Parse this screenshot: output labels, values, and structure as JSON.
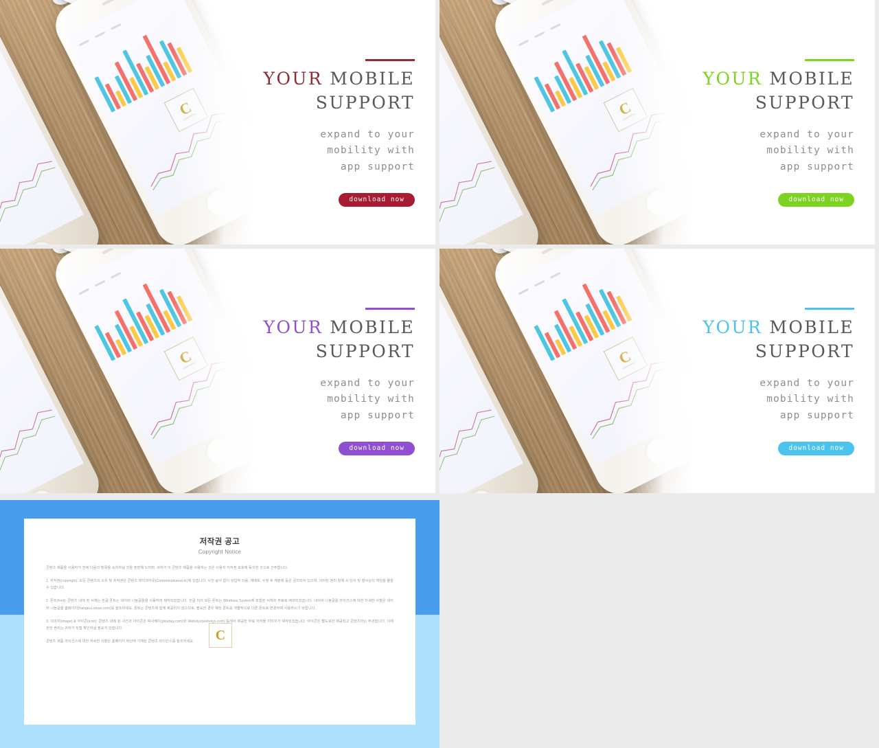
{
  "slides": [
    {
      "id": "slide-1",
      "accent_color": "#8d2b35",
      "button_color": "#a81b33",
      "title_line1_accent": "YOUR",
      "title_line1_rest": " MOBILE",
      "title_line2": "SUPPORT",
      "subtitle_line1": "expand to your",
      "subtitle_line2": "mobility with",
      "subtitle_line3": "app support",
      "cta_label": "download now"
    },
    {
      "id": "slide-2",
      "accent_color": "#7dd321",
      "button_color": "#7dd321",
      "title_line1_accent": "YOUR",
      "title_line1_rest": " MOBILE",
      "title_line2": "SUPPORT",
      "subtitle_line1": "expand to your",
      "subtitle_line2": "mobility with",
      "subtitle_line3": "app support",
      "cta_label": "download now"
    },
    {
      "id": "slide-3",
      "accent_color": "#8e4fd0",
      "button_color": "#8e4fd0",
      "title_line1_accent": "YOUR",
      "title_line1_rest": " MOBILE",
      "title_line2": "SUPPORT",
      "subtitle_line1": "expand to your",
      "subtitle_line2": "mobility with",
      "subtitle_line3": "app support",
      "cta_label": "download now"
    },
    {
      "id": "slide-4",
      "accent_color": "#4cc3ee",
      "button_color": "#4cc3ee",
      "title_line1_accent": "YOUR",
      "title_line1_rest": " MOBILE",
      "title_line2": "SUPPORT",
      "subtitle_line1": "expand to your",
      "subtitle_line2": "mobility with",
      "subtitle_line3": "app support",
      "cta_label": "download now"
    }
  ],
  "photo": {
    "watermark_letter": "C",
    "watermark_caption": "CONTENTS",
    "chart_colors": [
      "#4ec6e0",
      "#f4706b",
      "#fbc944"
    ]
  },
  "copyright": {
    "panel_color": "#4a9dee",
    "panel_color_lower": "#ace0fb",
    "title_ko": "저작권 공고",
    "title_en": "Copyright Notice",
    "watermark_letter": "C",
    "paragraphs": [
      "콘텐츠 제품을 사용하기 전에 다음의 항목을 숙지하실 것을 권장해 드리며, 귀하가 이 콘텐츠 제품을 사용하는 것은 사용자 저작권 보호에 동의한 것으로 간주합니다.",
      "1. 저작권(copyright): 모든 콘텐츠의 소유 및 저작권은 콘텐츠 테이크아웃(Contentstakeout.kr)에 있습니다. 사전 승낙 없이 상업적 이용, 재배포, 수정 후 재판매 등은 금지되어 있으며, 이러한 권리 침해 시 민사 및 형사상의 책임을 물을 수 있습니다.",
      "2. 폰트(font): 콘텐츠 내에 된 서체는 한글 폰트는 네이버 나눔글꼴을 사용하여 제작되었습니다. 한글 외의 모든 폰트는 Windows System에 포함된 서체와 무료로 배포되었습니다. 네이버 나눔글꼴 라이선스에 대한 자세한 사항은 네이버 나눔글꼴 홈페이지(hangeul.naver.com)를 참조하세요. 폰트는 콘텐츠에 함께 제공되지 않으므로, 필요한 경우 해당 폰트를 개별적으로 다른 폰트로 변경하여 사용하시기 바랍니다.",
      "3. 이미지(image) & 아이콘(icon): 콘텐츠 내에 된 사진과 아이콘은 픽사베이(pixabay.com)와 Webolys(webolys.com) 등에서 제공한 무료 저작물 이미지가 제작되었습니다. 아이콘은 별도로만 제공되고 콘텐츠와는 무관합니다. 이에 관한 권리는 귀하가 직접 확인하실 필요가 있습니다.",
      "콘텐츠 제품 라이선스에 대한 자세한 사항은 홈페이지 하단에 기재된 콘텐츠 라이선스를 참조하세요."
    ]
  }
}
